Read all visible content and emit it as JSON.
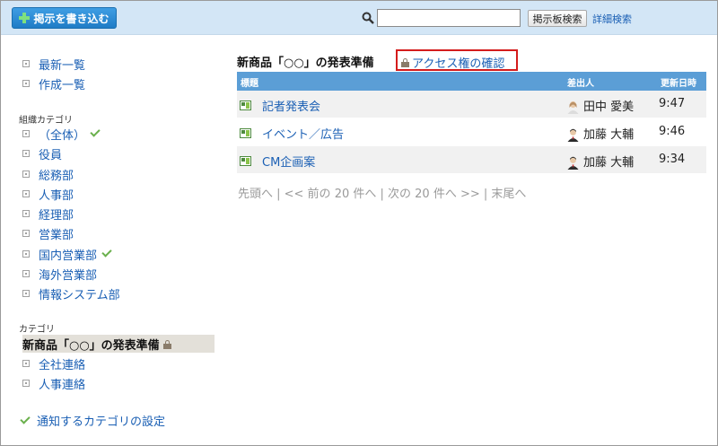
{
  "toolbar": {
    "post_button_label": "掲示を書き込む",
    "search_value": "",
    "search_button_label": "掲示板検索",
    "advanced_search_label": "詳細検索"
  },
  "sidebar": {
    "top_links": [
      {
        "label": "最新一覧"
      },
      {
        "label": "作成一覧"
      }
    ],
    "org_heading": "組織カテゴリ",
    "org_items": [
      {
        "label": "（全体）",
        "checked": true
      },
      {
        "label": "役員",
        "checked": false
      },
      {
        "label": "総務部",
        "checked": false
      },
      {
        "label": "人事部",
        "checked": false
      },
      {
        "label": "経理部",
        "checked": false
      },
      {
        "label": "営業部",
        "checked": false
      },
      {
        "label": "国内営業部",
        "checked": true
      },
      {
        "label": "海外営業部",
        "checked": false
      },
      {
        "label": "情報システム部",
        "checked": false
      }
    ],
    "cat_heading": "カテゴリ",
    "current_category": "新商品「○○」の発表準備",
    "cat_items": [
      {
        "label": "全社連絡"
      },
      {
        "label": "人事連絡"
      }
    ],
    "notify_link": "通知するカテゴリの設定"
  },
  "main": {
    "title": "新商品「○○」の発表準備",
    "access_link": "アクセス権の確認",
    "columns": {
      "subject": "標題",
      "sender": "差出人",
      "updated": "更新日時"
    },
    "rows": [
      {
        "subject": "記者発表会",
        "sender": "田中 愛美",
        "time": "9:47",
        "avatar": "female-avatar"
      },
      {
        "subject": "イベント／広告",
        "sender": "加藤 大輔",
        "time": "9:46",
        "avatar": "male-avatar"
      },
      {
        "subject": "CM企画案",
        "sender": "加藤 大輔",
        "time": "9:34",
        "avatar": "male-avatar"
      }
    ],
    "pager": "先頭へ | << 前の 20 件へ | 次の 20 件へ >> | 末尾へ"
  },
  "colors": {
    "topbar": "#d3e6f6",
    "accent": "#1f7cc6",
    "table_header": "#5b9ed6",
    "link": "#1a5fb4",
    "highlight_border": "#d41c1c",
    "check": "#6ab04c"
  }
}
